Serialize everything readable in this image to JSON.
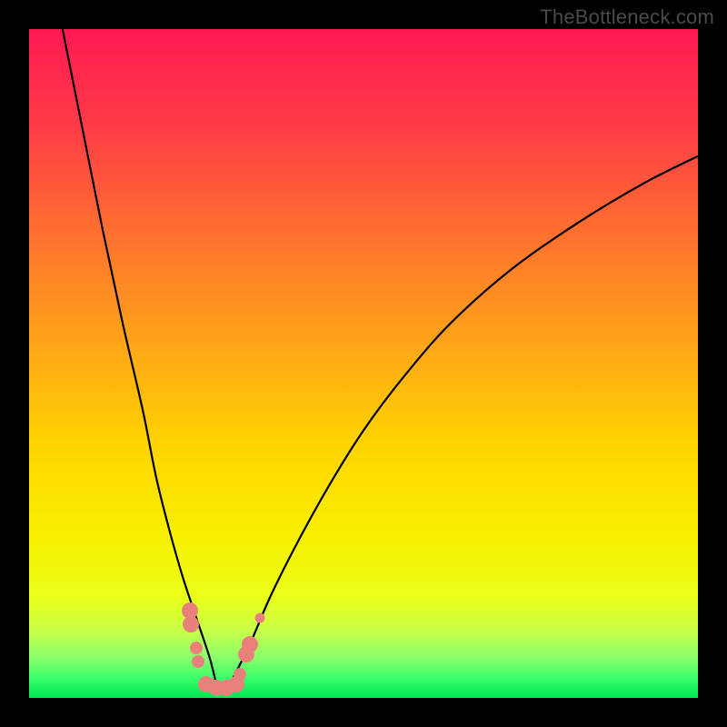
{
  "watermark": "TheBottleneck.com",
  "chart_data": {
    "type": "line",
    "title": "",
    "xlabel": "",
    "ylabel": "",
    "xlim": [
      0,
      100
    ],
    "ylim": [
      0,
      100
    ],
    "grid": false,
    "legend": false,
    "background_gradient": {
      "top_color": "#ff1a52",
      "middle_color": "#ffd400",
      "bottom_color": "#00e651",
      "description": "Vertical gradient red (top) through orange, yellow, to green (bottom) representing high-to-low bottleneck"
    },
    "series": [
      {
        "name": "left-branch",
        "description": "Steep descending curve from upper-left falling to minimum near x≈28",
        "x": [
          5,
          8,
          11,
          14,
          17,
          19,
          21,
          23,
          25,
          27,
          28
        ],
        "values": [
          100,
          85,
          70,
          56,
          43,
          33,
          25,
          18,
          12,
          6,
          2
        ]
      },
      {
        "name": "right-branch",
        "description": "Rising curve from minimum near x≈30 climbing asymptotically toward upper-right",
        "x": [
          30,
          33,
          36,
          40,
          45,
          50,
          56,
          63,
          72,
          82,
          92,
          100
        ],
        "values": [
          2,
          8,
          15,
          23,
          32,
          40,
          48,
          56,
          64,
          71,
          77,
          81
        ]
      }
    ],
    "markers": {
      "description": "Salmon-colored circular data points clustered near the curve minimum",
      "color": "#e8817b",
      "points": [
        {
          "x": 24.0,
          "y": 13.0,
          "size": "big"
        },
        {
          "x": 24.2,
          "y": 11.0,
          "size": "big"
        },
        {
          "x": 25.0,
          "y": 7.5,
          "size": "med"
        },
        {
          "x": 25.3,
          "y": 5.5,
          "size": "med"
        },
        {
          "x": 26.5,
          "y": 2.0,
          "size": "big"
        },
        {
          "x": 28.0,
          "y": 1.5,
          "size": "big"
        },
        {
          "x": 29.5,
          "y": 1.5,
          "size": "big"
        },
        {
          "x": 31.0,
          "y": 2.0,
          "size": "big"
        },
        {
          "x": 31.5,
          "y": 3.5,
          "size": "med"
        },
        {
          "x": 32.5,
          "y": 6.5,
          "size": "big"
        },
        {
          "x": 33.0,
          "y": 8.0,
          "size": "big"
        },
        {
          "x": 34.5,
          "y": 12.0,
          "size": "sm"
        }
      ]
    }
  }
}
